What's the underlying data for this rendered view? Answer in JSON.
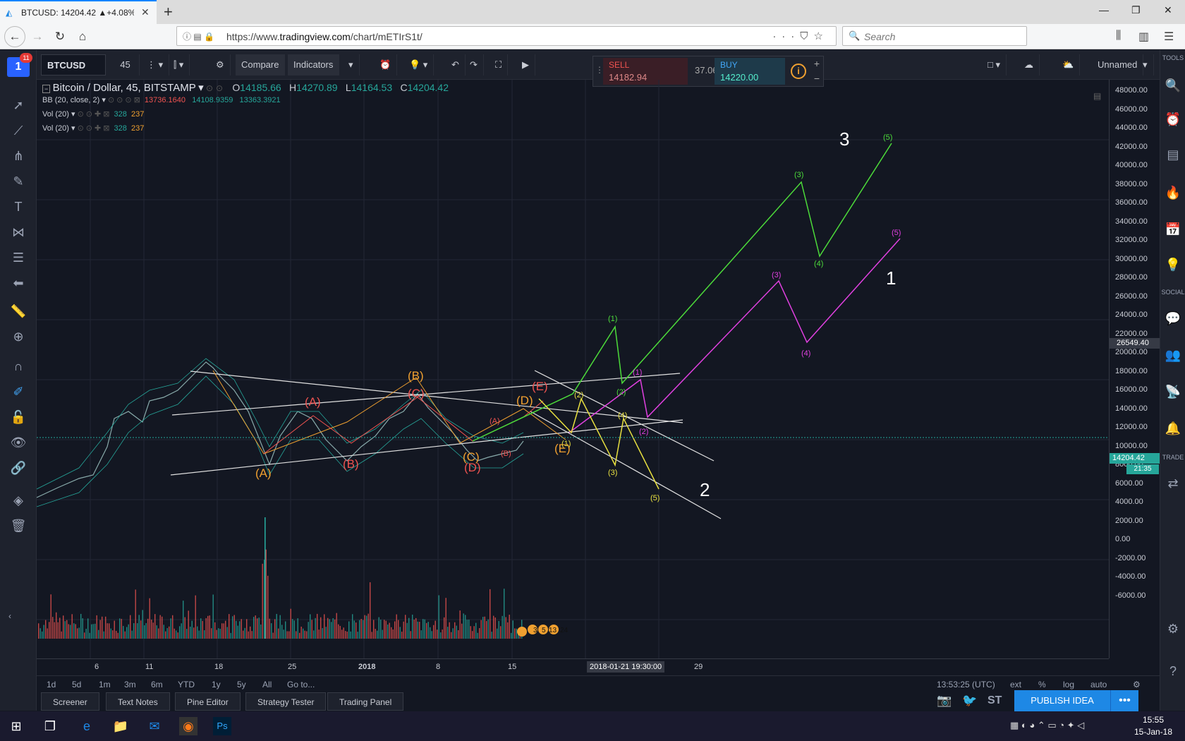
{
  "browser": {
    "tab_title": "BTCUSD: 14204.42 ▲+4.08% —",
    "url_prefix": "https://www.",
    "url_domain": "tradingview.com",
    "url_path": "/chart/mETIrS1t/",
    "search_placeholder": "Search"
  },
  "toolbar": {
    "symbol": "BTCUSD",
    "interval": "45",
    "compare_label": "Compare",
    "indicators_label": "Indicators",
    "layout_name": "Unnamed"
  },
  "trade": {
    "sell_label": "SELL",
    "sell_price": "14182.94",
    "spread": "37.06",
    "buy_label": "BUY",
    "buy_price": "14220.00"
  },
  "legend": {
    "title": "Bitcoin / Dollar, 45, BITSTAMP",
    "o_label": "O",
    "o_value": "14185.66",
    "h_label": "H",
    "h_value": "14270.89",
    "l_label": "L",
    "l_value": "14164.53",
    "c_label": "C",
    "c_value": "14204.42",
    "bb_label": "BB (20, close, 2)",
    "bb_v1": "13736.1640",
    "bb_v2": "14108.9359",
    "bb_v3": "13363.3921",
    "vol_label": "Vol (20)",
    "vol_v1": "328",
    "vol_v2": "237"
  },
  "notification_count": "11",
  "logo_text": "1",
  "price_scale": {
    "ticks": [
      "48000.00",
      "46000.00",
      "44000.00",
      "42000.00",
      "40000.00",
      "38000.00",
      "36000.00",
      "34000.00",
      "32000.00",
      "30000.00",
      "28000.00",
      "26000.00",
      "24000.00",
      "22000.00",
      "20000.00",
      "18000.00",
      "16000.00",
      "14000.00",
      "12000.00",
      "10000.00",
      "8000.00",
      "6000.00",
      "4000.00",
      "2000.00",
      "0.00",
      "-2000.00",
      "-4000.00",
      "-6000.00"
    ],
    "current_price": "14204.42",
    "countdown": "21:35",
    "crosshair_price": "26549.40"
  },
  "time_scale": {
    "ticks": [
      "6",
      "11",
      "18",
      "25",
      "2018",
      "8",
      "15",
      "29"
    ],
    "crosshair_time": "2018-01-21 19:30:00"
  },
  "ranges": [
    "1d",
    "5d",
    "1m",
    "3m",
    "6m",
    "YTD",
    "1y",
    "5y",
    "All"
  ],
  "goto_label": "Go to...",
  "right_status": {
    "time": "13:53:25 (UTC)",
    "ext": "ext",
    "pct": "%",
    "log": "log",
    "auto": "auto"
  },
  "bottom_tabs": [
    "Screener",
    "Text Notes",
    "Pine Editor",
    "Strategy Tester",
    "Trading Panel"
  ],
  "publish_label": "PUBLISH IDEA",
  "right_labels": {
    "tools": "TOOLS",
    "social": "SOCIAL",
    "trade": "TRADE"
  },
  "wave_labels": {
    "big_3": "3",
    "big_1": "1",
    "big_2": "2",
    "A_orange": "(A)",
    "B_orange": "(B)",
    "C_orange": "(C)",
    "D_orange": "(D)",
    "E_orange": "(E)",
    "A_red": "(A)",
    "B_red": "(B)",
    "C_red": "(C)",
    "D_red": "(D)",
    "E_red": "(E)",
    "g1": "(1)",
    "g2": "(2)",
    "g3": "(3)",
    "g4": "(4)",
    "g5": "(5)",
    "m1": "(1)",
    "m2": "(2)",
    "m3": "(3)",
    "m4": "(4)",
    "m5": "(5)",
    "y2": "(2)",
    "y3": "(3)",
    "y4": "(4)",
    "y5": "(5)",
    "y1": "(1)",
    "small_A": "(A)",
    "small_B": "(B)"
  },
  "bubbles": [
    "3",
    "5",
    "13",
    "24"
  ],
  "clock": {
    "time": "15:55",
    "date": "15-Jan-18"
  },
  "colors": {
    "green_wave": "#4cdb3a",
    "magenta_wave": "#e040e0",
    "yellow_wave": "#e8e040",
    "orange_wave": "#f0a030",
    "red_wave": "#ef5350",
    "accent": "#2962ff"
  }
}
